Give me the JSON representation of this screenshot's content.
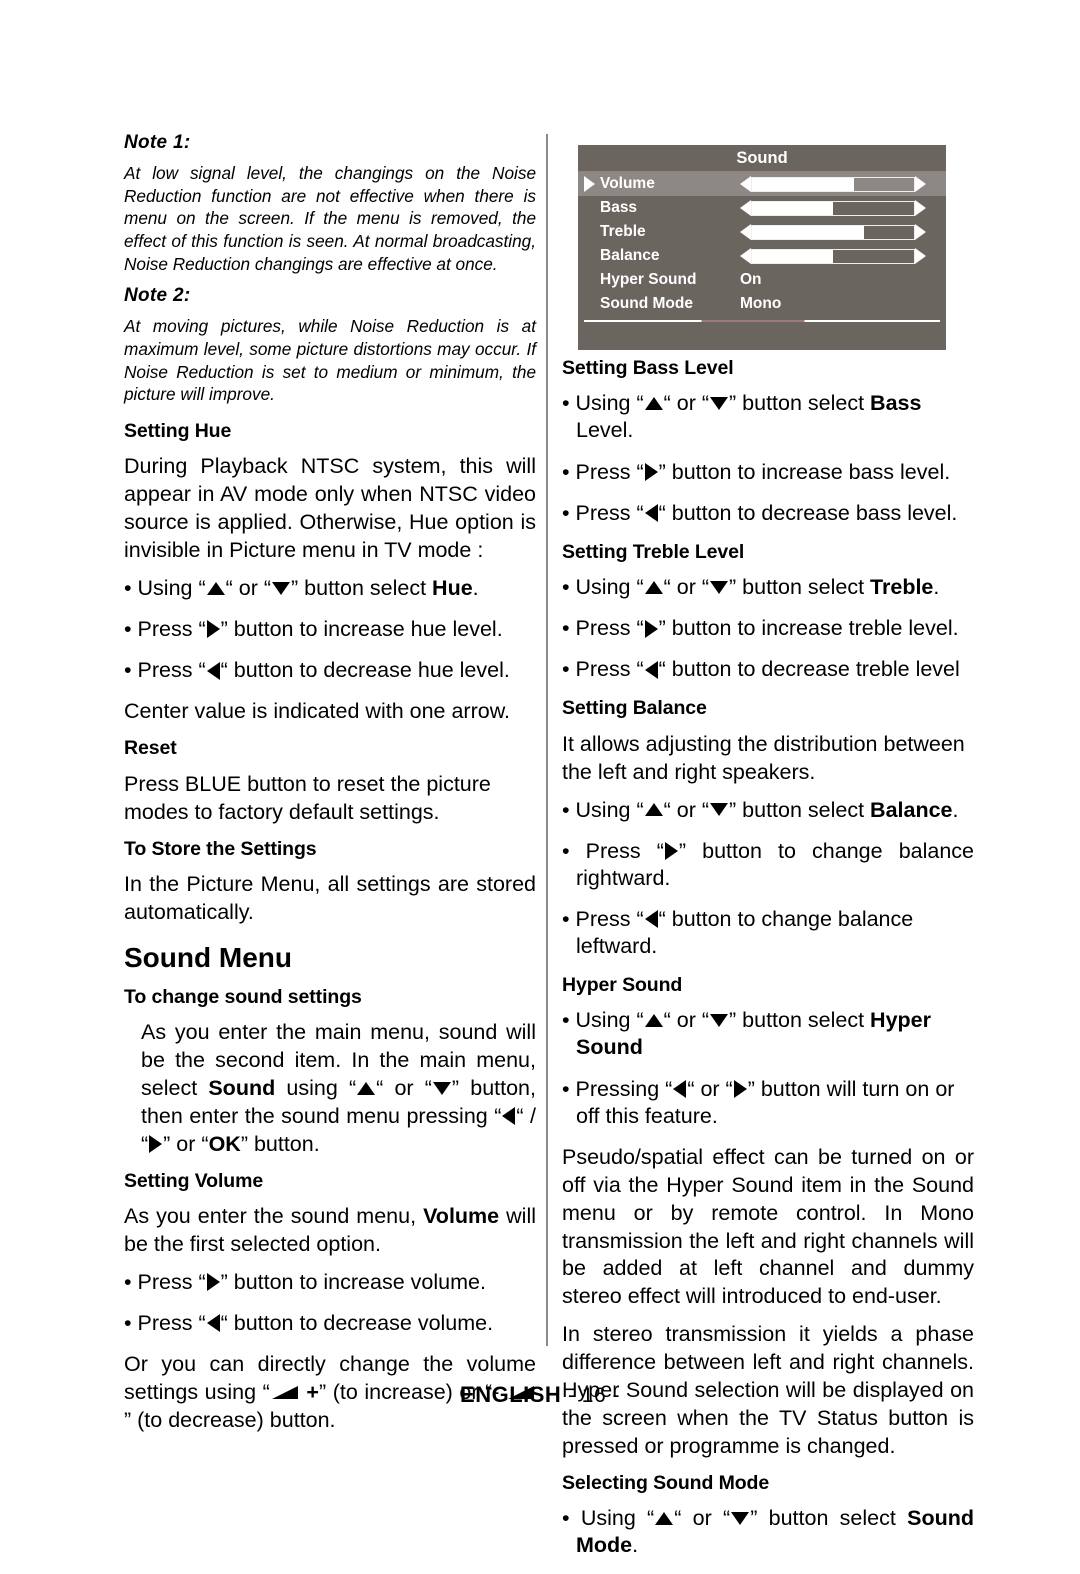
{
  "document": {
    "footer_language": "ENGLISH",
    "footer_page": "- 16 -"
  },
  "left_column": {
    "note1": {
      "heading": "Note  1:",
      "text": "At low signal level, the changings on the Noise Reduction function are not effective when there is menu on the screen. If the menu is removed, the effect of this function is seen. At normal broadcasting, Noise Reduction changings are effective at once."
    },
    "note2": {
      "heading": "Note  2:",
      "text": "At moving pictures, while Noise Reduction is at maximum level, some picture distortions may occur. If Noise Reduction is set to medium or minimum, the picture will improve."
    },
    "setting_hue": {
      "heading": "Setting Hue",
      "paragraph": "During Playback NTSC system, this will appear in AV mode only when NTSC video source is applied. Otherwise, Hue option is invisible in Picture menu in TV mode :",
      "bullet_select_pre": "Using “",
      "bullet_select_mid": "“ or “",
      "bullet_select_post": "” button select ",
      "bullet_select_target": "Hue",
      "bullet_select_end": ".",
      "bullet_increase_pre": "Press “",
      "bullet_increase_post": "” button to increase hue level.",
      "bullet_decrease_pre": "Press “",
      "bullet_decrease_post": "“ button to decrease hue level.",
      "center_note": "Center value is indicated with one arrow."
    },
    "reset": {
      "heading": "Reset",
      "text": "Press BLUE button to reset the picture modes to factory default settings."
    },
    "store_settings": {
      "heading": "To Store the Settings",
      "text": "In the Picture Menu, all settings are stored automatically."
    },
    "sound_menu_heading": "Sound Menu",
    "change_sound_settings": {
      "heading": "To change sound settings",
      "part1": "As you enter the main menu, sound will be the second item. In the main menu, select ",
      "bold1": "Sound",
      "part2": " using “",
      "part3": "“ or “",
      "part4": "” button, then enter the sound menu pressing “",
      "part5": "“ / “",
      "part6": "” or “",
      "bold2": "OK",
      "part7": "” button."
    },
    "setting_volume": {
      "heading": "Setting Volume",
      "intro_pre": "As you enter the sound menu, ",
      "intro_bold": "Volume",
      "intro_post": " will be the first selected option.",
      "bullet_increase_pre": "Press “",
      "bullet_increase_post": "” button to increase volume.",
      "bullet_decrease_pre": "Press “",
      "bullet_decrease_post": "“ button to decrease volume.",
      "direct_pre": "Or you can directly change the volume settings using “",
      "direct_plus": " +",
      "direct_mid": "” (to increase) or “- ",
      "direct_post": "” (to decrease) button."
    }
  },
  "osd": {
    "title": "Sound",
    "rows": [
      {
        "label": "Volume",
        "type": "slider",
        "fill_percent": 63,
        "selected": true
      },
      {
        "label": "Bass",
        "type": "slider",
        "fill_percent": 50,
        "selected": false
      },
      {
        "label": "Treble",
        "type": "slider",
        "fill_percent": 69,
        "selected": false
      },
      {
        "label": "Balance",
        "type": "slider",
        "fill_percent": 50,
        "selected": false
      },
      {
        "label": "Hyper Sound",
        "type": "value",
        "value": "On",
        "selected": false
      },
      {
        "label": "Sound Mode",
        "type": "value",
        "value": "Mono",
        "selected": false
      }
    ],
    "colors": {
      "background": "#6b6560",
      "selected_row": "#8d8883",
      "text": "#ffffff",
      "accent_rule": "#a07a7a"
    }
  },
  "right_column": {
    "setting_bass": {
      "heading": "Setting Bass Level",
      "bullet_select_pre": "Using “",
      "bullet_select_mid": "“ or “",
      "bullet_select_post": "” button select ",
      "bullet_select_target": "Bass",
      "bullet_select_end": " Level.",
      "bullet_increase_pre": "Press “",
      "bullet_increase_post": "” button to increase bass level.",
      "bullet_decrease_pre": "Press “",
      "bullet_decrease_post": "“  button to decrease bass level."
    },
    "setting_treble": {
      "heading": "Setting Treble Level",
      "bullet_select_pre": "Using “",
      "bullet_select_mid": "“ or “",
      "bullet_select_post": "” button select ",
      "bullet_select_target": "Treble",
      "bullet_select_end": ".",
      "bullet_increase_pre": "Press  “",
      "bullet_increase_post": "” button to increase treble level.",
      "bullet_decrease_pre": "Press “",
      "bullet_decrease_post": "“  button to decrease treble level"
    },
    "setting_balance": {
      "heading": "Setting Balance",
      "intro": "It allows adjusting the distribution between the left and right speakers.",
      "bullet_select_pre": "Using “",
      "bullet_select_mid": "“ or “",
      "bullet_select_post": "” button select ",
      "bullet_select_target": "Balance",
      "bullet_select_end": ".",
      "bullet_right_pre": "Press “",
      "bullet_right_post": "” button to change balance rightward.",
      "bullet_left_pre": "Press “",
      "bullet_left_post": "“ button to change balance leftward."
    },
    "hyper_sound": {
      "heading": "Hyper Sound",
      "bullet_select_pre": "Using “",
      "bullet_select_mid": "“ or “",
      "bullet_select_post": "” button select ",
      "bullet_select_target": "Hyper Sound",
      "bullet_press_pre": "Pressing “",
      "bullet_press_mid": "“ or “",
      "bullet_press_post": "”  button will turn on or off this feature.",
      "paragraph1": "Pseudo/spatial effect can be turned on or off via the Hyper Sound item in the Sound menu or by remote control. In Mono transmission the left and right channels will be added at left channel and dummy stereo effect will introduced to end-user.",
      "paragraph2": "In stereo transmission it yields a phase difference between left and right channels. Hyper Sound selection will be displayed on the screen when the TV Status button is pressed or programme is changed."
    },
    "selecting_sound_mode": {
      "heading": "Selecting Sound Mode",
      "bullet_select_pre": "Using  “",
      "bullet_select_mid": "“ or “",
      "bullet_select_post": "” button select ",
      "bullet_select_target": "Sound Mode",
      "bullet_select_end": "."
    }
  }
}
